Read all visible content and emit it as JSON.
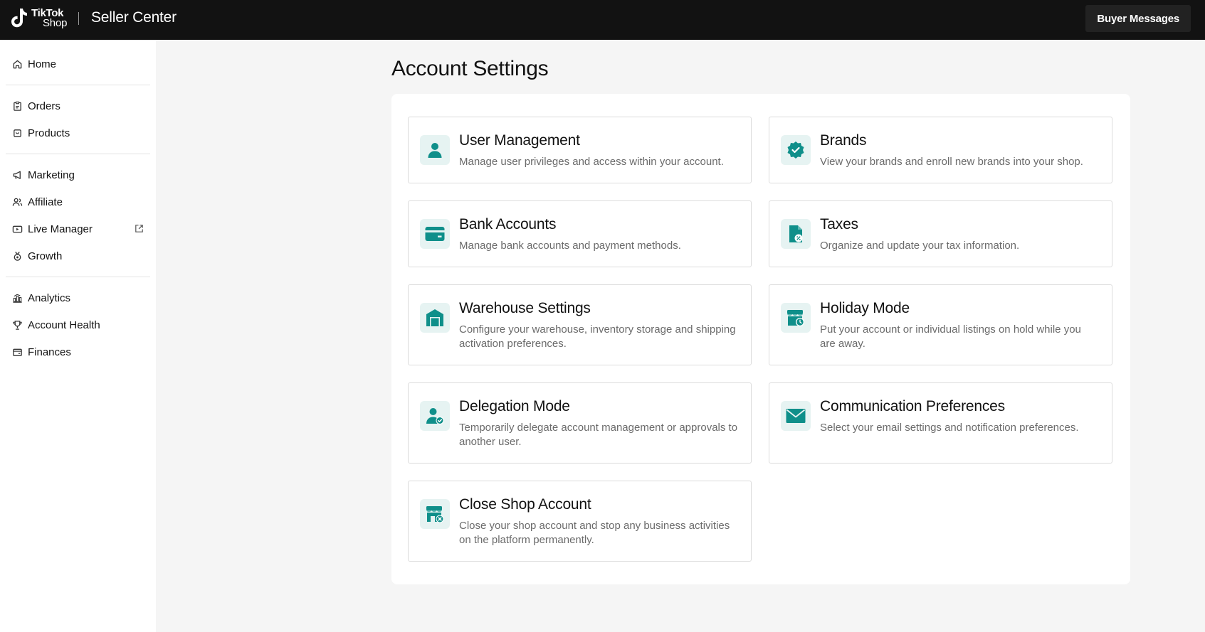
{
  "header": {
    "logo_line1": "TikTok",
    "logo_line2": "Shop",
    "app_title": "Seller Center",
    "buyer_messages_label": "Buyer Messages"
  },
  "sidebar": {
    "groups": [
      [
        {
          "label": "Home",
          "icon": "home-icon"
        }
      ],
      [
        {
          "label": "Orders",
          "icon": "clipboard-icon"
        },
        {
          "label": "Products",
          "icon": "box-icon"
        }
      ],
      [
        {
          "label": "Marketing",
          "icon": "megaphone-icon"
        },
        {
          "label": "Affiliate",
          "icon": "users-icon"
        },
        {
          "label": "Live Manager",
          "icon": "video-icon",
          "external": true
        },
        {
          "label": "Growth",
          "icon": "medal-icon"
        }
      ],
      [
        {
          "label": "Analytics",
          "icon": "bar-chart-icon"
        },
        {
          "label": "Account Health",
          "icon": "trophy-icon"
        },
        {
          "label": "Finances",
          "icon": "wallet-icon"
        }
      ]
    ]
  },
  "main": {
    "title": "Account Settings",
    "cards": [
      {
        "title": "User Management",
        "desc": "Manage user privileges and access within your account.",
        "icon": "user-icon"
      },
      {
        "title": "Brands",
        "desc": "View your brands and enroll new brands into your shop.",
        "icon": "verified-badge-icon"
      },
      {
        "title": "Bank Accounts",
        "desc": "Manage bank accounts and payment methods.",
        "icon": "credit-card-icon"
      },
      {
        "title": "Taxes",
        "desc": "Organize and update your tax information.",
        "icon": "tax-document-icon"
      },
      {
        "title": "Warehouse Settings",
        "desc": "Configure your warehouse, inventory storage and shipping activation preferences.",
        "icon": "warehouse-icon"
      },
      {
        "title": "Holiday Mode",
        "desc": "Put your account or individual listings on hold while you are away.",
        "icon": "store-clock-icon"
      },
      {
        "title": "Delegation Mode",
        "desc": "Temporarily delegate account management or approvals to another user.",
        "icon": "user-check-icon"
      },
      {
        "title": "Communication Preferences",
        "desc": "Select your email settings and notification preferences.",
        "icon": "envelope-icon"
      },
      {
        "title": "Close Shop Account",
        "desc": "Close your shop account and stop any business activities on the platform permanently.",
        "icon": "store-close-icon"
      }
    ]
  },
  "colors": {
    "topbar": "#121212",
    "accent_teal": "#0f8f8a",
    "icon_bg": "#e6f3f2",
    "page_bg": "#f5f5f5"
  }
}
